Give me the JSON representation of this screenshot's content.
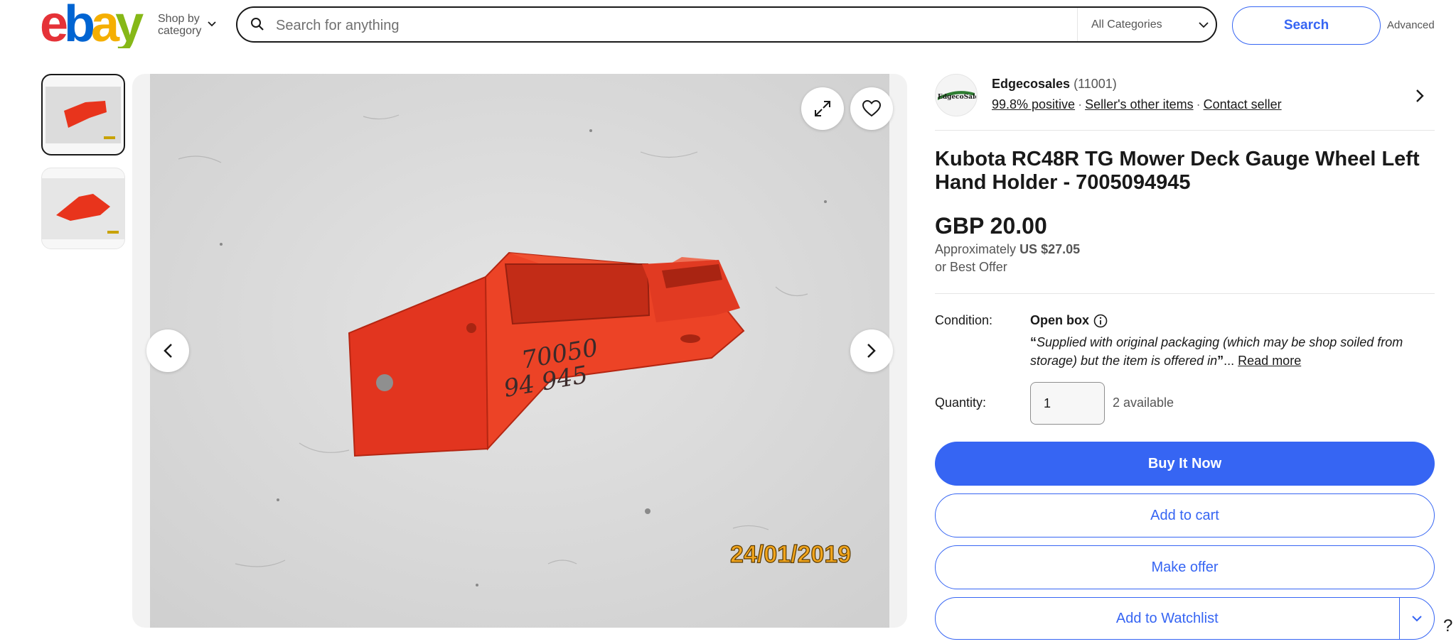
{
  "header": {
    "logo_text": "ebay",
    "shop_by_line1": "Shop by",
    "shop_by_line2": "category",
    "search_placeholder": "Search for anything",
    "category_select": "All Categories",
    "search_button": "Search",
    "advanced_link": "Advanced"
  },
  "gallery": {
    "date_stamp": "24/01/2019",
    "part_number_line1": "70050",
    "part_number_line2": "94 945",
    "thumbnail_count": 2
  },
  "seller": {
    "avatar_text": "EdgecoSales",
    "name": "Edgecosales",
    "feedback_count": "(11001)",
    "positive": "99.8% positive",
    "other_items": "Seller's other items",
    "contact": "Contact seller"
  },
  "listing": {
    "title": "Kubota RC48R TG Mower Deck Gauge Wheel Left Hand Holder - 7005094945",
    "price": "GBP 20.00",
    "approx_label": "Approximately",
    "approx_value": "US $27.05",
    "best_offer": "or Best Offer",
    "condition_label": "Condition:",
    "condition_value": "Open box",
    "condition_quote_open": "“",
    "condition_desc": "Supplied with original packaging (which may be shop soiled from storage) but the item is offered in",
    "condition_quote_close": "”",
    "condition_ellipsis": "... ",
    "read_more": "Read more",
    "quantity_label": "Quantity:",
    "quantity_value": "1",
    "quantity_available": "2 available"
  },
  "actions": {
    "buy_now": "Buy It Now",
    "add_to_cart": "Add to cart",
    "make_offer": "Make offer",
    "add_to_watchlist": "Add to Watchlist"
  },
  "help": "?",
  "colors": {
    "accent": "#3665f3",
    "text": "#191919",
    "muted": "#555555",
    "part_red": "#e8341c"
  }
}
